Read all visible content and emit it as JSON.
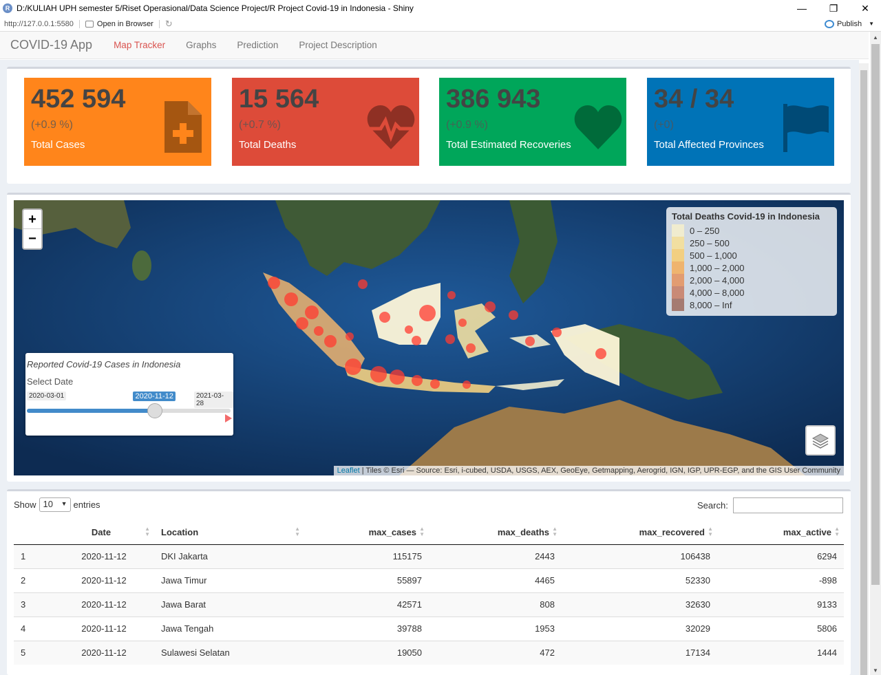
{
  "window": {
    "title": "D:/KULIAH UPH semester 5/Riset Operasional/Data Science Project/R Project Covid-19 in Indonesia - Shiny",
    "minimize": "—",
    "restore": "❐",
    "close": "✕"
  },
  "toolbar": {
    "url": "http://127.0.0.1:5580",
    "open_browser": "Open in Browser",
    "publish": "Publish"
  },
  "navbar": {
    "brand": "COVID-19 App",
    "items": [
      "Map Tracker",
      "Graphs",
      "Prediction",
      "Project Description"
    ],
    "active": "Map Tracker"
  },
  "value_boxes": [
    {
      "value": "452 594",
      "change": "(+0.9 %)",
      "label": "Total Cases",
      "icon": "file-medical-icon",
      "color": "#ff851b"
    },
    {
      "value": "15 564",
      "change": "(+0.7 %)",
      "label": "Total Deaths",
      "icon": "heartbeat-icon",
      "color": "#dd4b39"
    },
    {
      "value": "386 943",
      "change": "(+0.9 %)",
      "label": "Total Estimated Recoveries",
      "icon": "heart-icon",
      "color": "#00a65a"
    },
    {
      "value": "34 / 34",
      "change": "(+0)",
      "label": "Total Affected Provinces",
      "icon": "flag-icon",
      "color": "#0073b7"
    }
  ],
  "map": {
    "zoom_in": "+",
    "zoom_out": "−",
    "legend": {
      "title": "Total Deaths Covid-19 in Indonesia",
      "bins": [
        {
          "label": "0 – 250",
          "color": "#f0eccf"
        },
        {
          "label": "250 – 500",
          "color": "#f1dfa1"
        },
        {
          "label": "500 – 1,000",
          "color": "#f2cf81"
        },
        {
          "label": "1,000 – 2,000",
          "color": "#efb46e"
        },
        {
          "label": "2,000 – 4,000",
          "color": "#e29c71"
        },
        {
          "label": "4,000 – 8,000",
          "color": "#c98a76"
        },
        {
          "label": "8,000 – Inf",
          "color": "#a57b72"
        }
      ]
    },
    "slider": {
      "title": "Reported Covid-19 Cases in Indonesia",
      "label": "Select Date",
      "min": "2020-03-01",
      "max": "2021-03-28",
      "current": "2020-11-12",
      "fraction": 0.63
    },
    "attribution_link": "Leaflet",
    "attribution_text": " | Tiles © Esri — Source: Esri, i-cubed, USDA, USGS, AEX, GeoEye, Getmapping, Aerogrid, IGN, IGP, UPR-EGP, and the GIS User Community"
  },
  "table": {
    "show": "Show",
    "length": "10",
    "entries": "entries",
    "search_label": "Search:",
    "columns": [
      "",
      "Date",
      "Location",
      "max_cases",
      "max_deaths",
      "max_recovered",
      "max_active"
    ],
    "rows": [
      [
        "1",
        "2020-11-12",
        "DKI Jakarta",
        "115175",
        "2443",
        "106438",
        "6294"
      ],
      [
        "2",
        "2020-11-12",
        "Jawa Timur",
        "55897",
        "4465",
        "52330",
        "-898"
      ],
      [
        "3",
        "2020-11-12",
        "Jawa Barat",
        "42571",
        "808",
        "32630",
        "9133"
      ],
      [
        "4",
        "2020-11-12",
        "Jawa Tengah",
        "39788",
        "1953",
        "32029",
        "5806"
      ],
      [
        "5",
        "2020-11-12",
        "Sulawesi Selatan",
        "19050",
        "472",
        "17134",
        "1444"
      ]
    ]
  }
}
